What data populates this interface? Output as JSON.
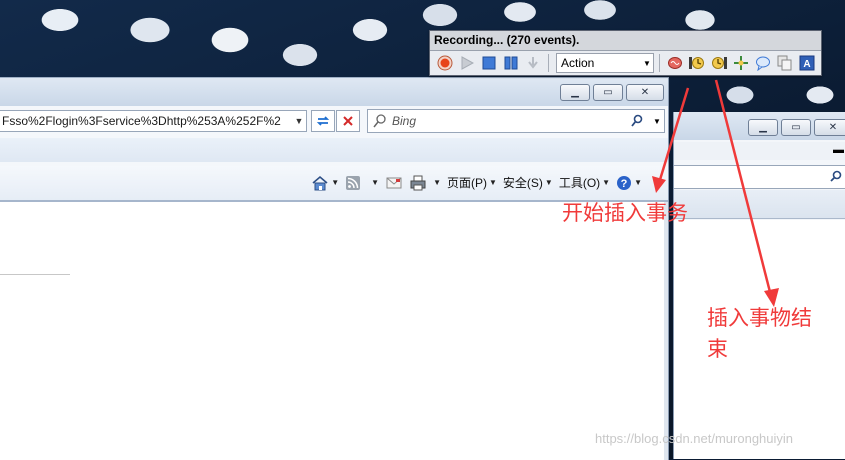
{
  "recording_toolbar": {
    "status": "Recording... (270 events).",
    "action_select": "Action",
    "icons": [
      "record-icon",
      "play-icon",
      "stop-icon",
      "pause-icon",
      "step-icon",
      "brain-icon",
      "start-transaction-icon",
      "end-transaction-icon",
      "rendezvous-icon",
      "comment-icon",
      "copy-icon",
      "text-check-icon"
    ]
  },
  "browser": {
    "address_text": "Fsso%2Flogin%3Fservice%3Dhttp%253A%252F%2",
    "search_placeholder": "Bing",
    "menu": {
      "page": "页面(P)",
      "safety": "安全(S)",
      "tools": "工具(O)"
    }
  },
  "annotations": {
    "start_transaction": "开始插入事务",
    "end_transaction": "插入事物结束"
  },
  "watermark": "https://blog.csdn.net/muronghuiyin",
  "colors": {
    "annotation": "#f03a3a",
    "record": "#e8441a",
    "accent": "#2f6fd0"
  }
}
